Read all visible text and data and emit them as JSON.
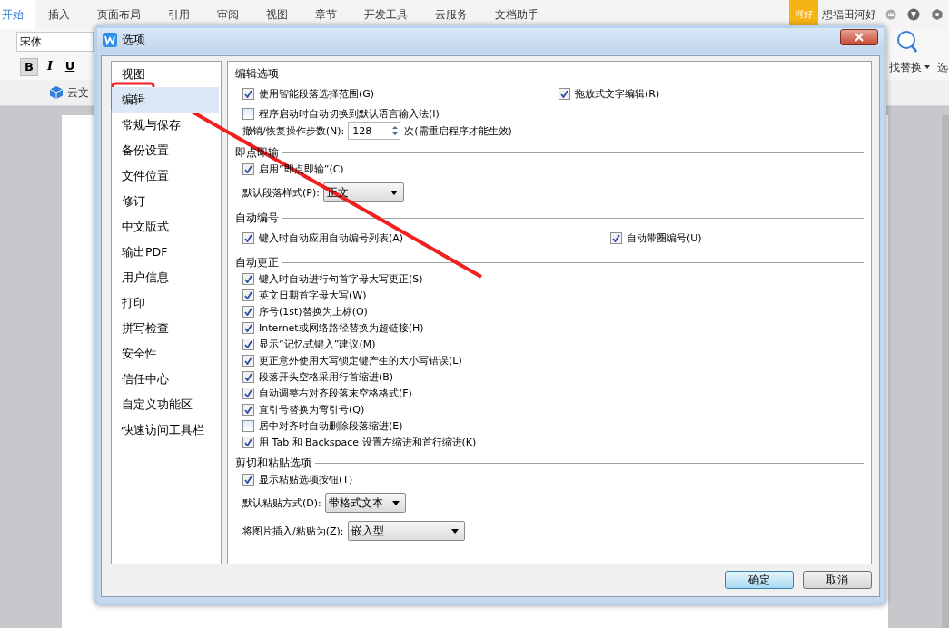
{
  "ribbon": {
    "tabs": [
      {
        "label": "开始",
        "selected": true
      },
      {
        "label": "插入",
        "selected": false
      },
      {
        "label": "页面布局",
        "selected": false
      },
      {
        "label": "引用",
        "selected": false
      },
      {
        "label": "审阅",
        "selected": false
      },
      {
        "label": "视图",
        "selected": false
      },
      {
        "label": "章节",
        "selected": false
      },
      {
        "label": "开发工具",
        "selected": false
      },
      {
        "label": "云服务",
        "selected": false
      },
      {
        "label": "文档助手",
        "selected": false
      }
    ],
    "badge": "河好",
    "user": "想福田河好",
    "font_field": {
      "value": "宋体"
    },
    "format_buttons": [
      "B",
      "I",
      "U"
    ],
    "find_replace": "找替换",
    "cut_label": "选",
    "cloud_doc": "云文"
  },
  "dialog": {
    "title": "选项",
    "categories": [
      {
        "label": "视图",
        "selected": false
      },
      {
        "label": "编辑",
        "selected": true
      },
      {
        "label": "常规与保存",
        "selected": false
      },
      {
        "label": "备份设置",
        "selected": false
      },
      {
        "label": "文件位置",
        "selected": false
      },
      {
        "label": "修订",
        "selected": false
      },
      {
        "label": "中文版式",
        "selected": false
      },
      {
        "label": "输出PDF",
        "selected": false
      },
      {
        "label": "用户信息",
        "selected": false
      },
      {
        "label": "打印",
        "selected": false
      },
      {
        "label": "拼写检查",
        "selected": false
      },
      {
        "label": "安全性",
        "selected": false
      },
      {
        "label": "信任中心",
        "selected": false
      },
      {
        "label": "自定义功能区",
        "selected": false
      },
      {
        "label": "快速访问工具栏",
        "selected": false
      }
    ],
    "sections": [
      {
        "title": "编辑选项",
        "rows": [
          {
            "kind": "pair",
            "items": [
              {
                "label": "使用智能段落选择范围(G)",
                "checked": true
              },
              {
                "label": "拖放式文字编辑(R)",
                "checked": true
              }
            ]
          },
          {
            "kind": "checkbox",
            "label": "程序启动时自动切换到默认语言输入法(I)",
            "checked": false
          },
          {
            "kind": "spinner",
            "label": "撤销/恢复操作步数(N):",
            "value": "128",
            "suffix": "次(需重启程序才能生效)"
          }
        ]
      },
      {
        "title": "即点即输",
        "rows": [
          {
            "kind": "checkbox",
            "label": "启用“即点即输”(C)",
            "checked": true
          },
          {
            "kind": "select",
            "label": "默认段落样式(P):",
            "value": "正文"
          }
        ]
      },
      {
        "title": "自动编号",
        "rows": [
          {
            "kind": "pair",
            "items": [
              {
                "label": "键入时自动应用自动编号列表(A)",
                "checked": true
              },
              {
                "label": "自动带圈编号(U)",
                "checked": true
              }
            ]
          }
        ]
      },
      {
        "title": "自动更正",
        "rows": [
          {
            "kind": "checkbox",
            "label": "键入时自动进行句首字母大写更正(S)",
            "checked": true
          },
          {
            "kind": "checkbox",
            "label": "英文日期首字母大写(W)",
            "checked": true
          },
          {
            "kind": "checkbox",
            "label": "序号(1st)替换为上标(O)",
            "checked": true
          },
          {
            "kind": "checkbox",
            "label": "Internet或网络路径替换为超链接(H)",
            "checked": true
          },
          {
            "kind": "checkbox",
            "label": "显示“记忆式键入”建议(M)",
            "checked": true
          },
          {
            "kind": "checkbox",
            "label": "更正意外使用大写锁定键产生的大小写错误(L)",
            "checked": true
          },
          {
            "kind": "checkbox",
            "label": "段落开头空格采用行首缩进(B)",
            "checked": true
          },
          {
            "kind": "checkbox",
            "label": "自动调整右对齐段落末空格格式(F)",
            "checked": true
          },
          {
            "kind": "checkbox",
            "label": "直引号替换为弯引号(Q)",
            "checked": true
          },
          {
            "kind": "checkbox",
            "label": "居中对齐时自动删除段落缩进(E)",
            "checked": false
          },
          {
            "kind": "checkbox",
            "label": "用 Tab 和 Backspace 设置左缩进和首行缩进(K)",
            "checked": true
          }
        ]
      },
      {
        "title": "剪切和粘贴选项",
        "rows": [
          {
            "kind": "checkbox",
            "label": "显示粘贴选项按钮(T)",
            "checked": true
          },
          {
            "kind": "select",
            "label": "默认粘贴方式(D):",
            "value": "带格式文本"
          },
          {
            "kind": "select",
            "label": "将图片插入/粘贴为(Z):",
            "value": "嵌入型",
            "wide": true
          }
        ]
      }
    ],
    "buttons": [
      "确定",
      "取消"
    ]
  }
}
